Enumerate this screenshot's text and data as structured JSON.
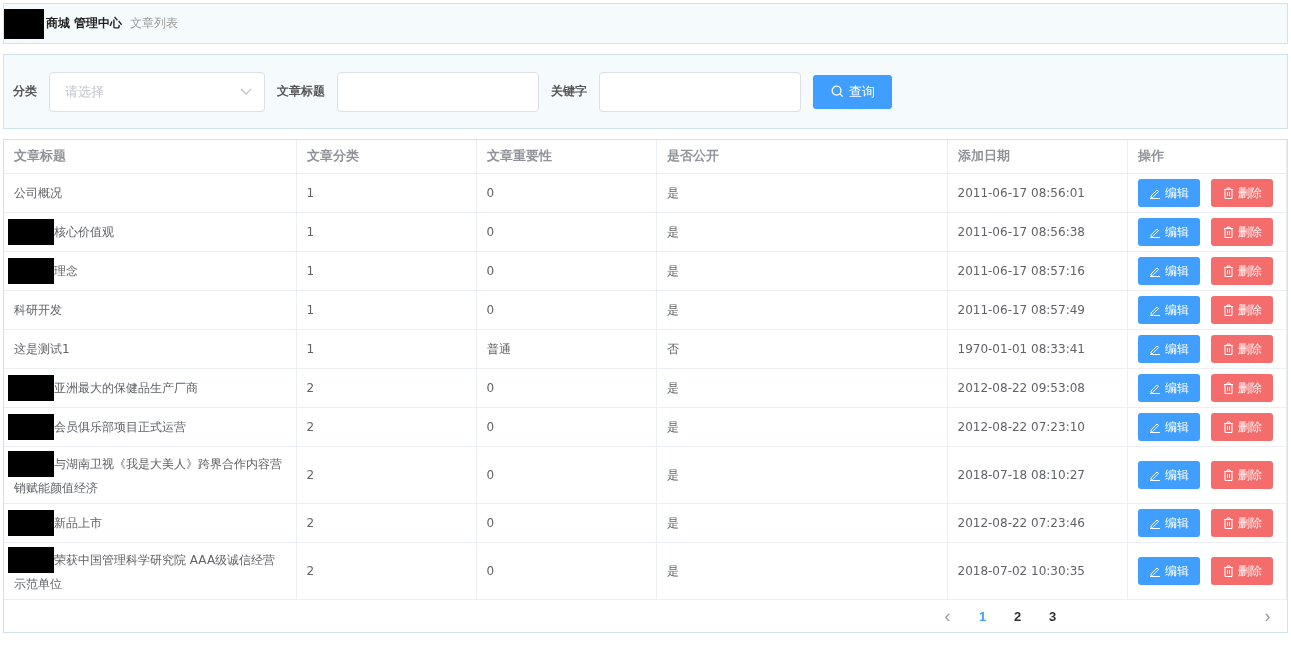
{
  "breadcrumb": [
    {
      "label": "商城 管理中心",
      "redacted": true,
      "current": false
    },
    {
      "label": "文章列表",
      "redacted": false,
      "current": true
    }
  ],
  "filters": {
    "category": {
      "label": "分类",
      "placeholder": "请选择"
    },
    "title": {
      "label": "文章标题"
    },
    "keyword": {
      "label": "关键字"
    },
    "search_button": "查询"
  },
  "table": {
    "columns": [
      "文章标题",
      "文章分类",
      "文章重要性",
      "是否公开",
      "添加日期",
      "操作"
    ],
    "rows": [
      {
        "title": "公司概况",
        "redacted": false,
        "category": "1",
        "importance": "0",
        "public": "是",
        "date": "2011-06-17 08:56:01"
      },
      {
        "title": "核心价值观",
        "redacted": true,
        "category": "1",
        "importance": "0",
        "public": "是",
        "date": "2011-06-17 08:56:38"
      },
      {
        "title": "理念",
        "redacted": true,
        "category": "1",
        "importance": "0",
        "public": "是",
        "date": "2011-06-17 08:57:16"
      },
      {
        "title": "科研开发",
        "redacted": false,
        "category": "1",
        "importance": "0",
        "public": "是",
        "date": "2011-06-17 08:57:49"
      },
      {
        "title": "这是测试1",
        "redacted": false,
        "category": "1",
        "importance": "普通",
        "public": "否",
        "date": "1970-01-01 08:33:41"
      },
      {
        "title": "亚洲最大的保健品生产厂商",
        "redacted": true,
        "category": "2",
        "importance": "0",
        "public": "是",
        "date": "2012-08-22 09:53:08"
      },
      {
        "title": "会员俱乐部项目正式运营",
        "redacted": true,
        "category": "2",
        "importance": "0",
        "public": "是",
        "date": "2012-08-22 07:23:10"
      },
      {
        "title": "与湖南卫视《我是大美人》跨界合作内容营销赋能颜值经济",
        "redacted": true,
        "category": "2",
        "importance": "0",
        "public": "是",
        "date": "2018-07-18 08:10:27"
      },
      {
        "title": "新品上市",
        "redacted": true,
        "category": "2",
        "importance": "0",
        "public": "是",
        "date": "2012-08-22 07:23:46"
      },
      {
        "title": "荣获中国管理科学研究院 AAA级诚信经营示范单位",
        "redacted": true,
        "category": "2",
        "importance": "0",
        "public": "是",
        "date": "2018-07-02 10:30:35"
      }
    ],
    "actions": [
      {
        "edit": "编辑",
        "delete": "删除"
      },
      {
        "edit": "编辑",
        "delete": "删除"
      },
      {
        "edit": "编辑",
        "delete": "删除"
      },
      {
        "edit": "编辑",
        "delete": "删除"
      },
      {
        "edit": "编辑",
        "delete": "删除"
      },
      {
        "edit": "编辑",
        "delete": "删除"
      },
      {
        "edit": "编辑",
        "delete": "删除"
      },
      {
        "edit": "编辑",
        "delete": "删除"
      },
      {
        "edit": "编辑",
        "delete": "删除"
      },
      {
        "edit": "编辑",
        "delete": "删除"
      }
    ]
  },
  "pagination": {
    "previous": "‹",
    "next": "›",
    "pages": [
      {
        "label": "1",
        "selected": true
      },
      {
        "label": "2",
        "selected": false
      },
      {
        "label": "3",
        "selected": false
      }
    ]
  }
}
